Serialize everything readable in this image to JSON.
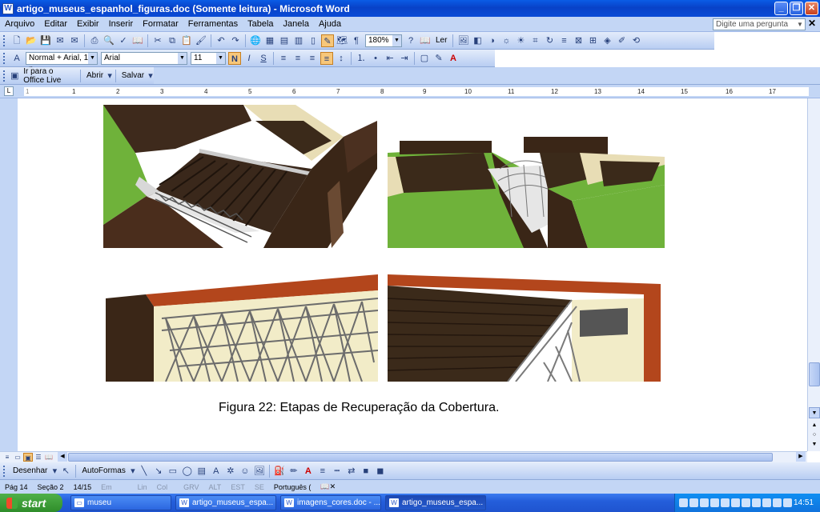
{
  "window": {
    "title": "artigo_museus_espanhol_figuras.doc (Somente leitura) - Microsoft Word"
  },
  "menu": {
    "items": [
      "Arquivo",
      "Editar",
      "Exibir",
      "Inserir",
      "Formatar",
      "Ferramentas",
      "Tabela",
      "Janela",
      "Ajuda"
    ],
    "ask_placeholder": "Digite uma pergunta"
  },
  "standard_toolbar": {
    "zoom": "180%",
    "read_label": "Ler"
  },
  "format_toolbar": {
    "style": "Normal + Arial, 11 p",
    "font": "Arial",
    "size": "11",
    "bold": "N",
    "italic": "I",
    "underline": "S"
  },
  "web_toolbar": {
    "office_live": "Ir para o Office Live",
    "open": "Abrir",
    "save": "Salvar"
  },
  "ruler": {
    "numbers": [
      "1",
      "1",
      "2",
      "3",
      "4",
      "5",
      "6",
      "7",
      "8",
      "9",
      "10",
      "11",
      "12",
      "13",
      "14",
      "15",
      "16",
      "17"
    ]
  },
  "document": {
    "caption": "Figura 22: Etapas de Recuperação da Cobertura."
  },
  "drawing_toolbar": {
    "draw": "Desenhar",
    "autoshapes": "AutoFormas"
  },
  "status": {
    "page": "Pág 14",
    "section": "Seção 2",
    "pages": "14/15",
    "at": "Em",
    "line": "Lin",
    "col": "Col",
    "grv": "GRV",
    "alt": "ALT",
    "est": "EST",
    "se": "SE",
    "lang": "Português ("
  },
  "taskbar": {
    "start": "start",
    "tasks": [
      "museu",
      "artigo_museus_espa...",
      "imagens_cores.doc - ...",
      "artigo_museus_espa..."
    ],
    "clock": "14:51"
  }
}
